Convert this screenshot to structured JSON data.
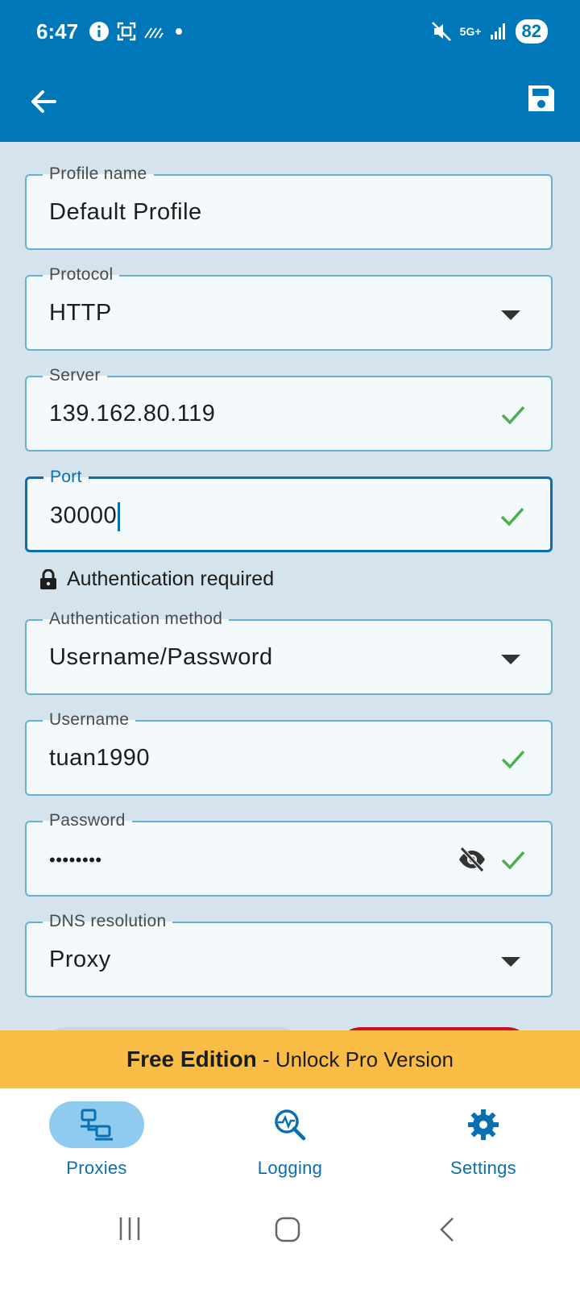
{
  "status": {
    "time": "6:47",
    "network": "5G+",
    "battery": "82"
  },
  "appbar": {
    "back_icon": "arrow-left-icon",
    "save_icon": "save-icon"
  },
  "fields": {
    "profile_name": {
      "label": "Profile name",
      "value": "Default Profile"
    },
    "protocol": {
      "label": "Protocol",
      "value": "HTTP"
    },
    "server": {
      "label": "Server",
      "value": "139.162.80.119"
    },
    "port": {
      "label": "Port",
      "value": "30000"
    },
    "auth_method": {
      "label": "Authentication method",
      "value": "Username/Password"
    },
    "username": {
      "label": "Username",
      "value": "tuan1990"
    },
    "password": {
      "label": "Password",
      "value": "••••••••"
    },
    "dns": {
      "label": "DNS resolution",
      "value": "Proxy"
    }
  },
  "auth_note": "Authentication required",
  "promo": {
    "bold": "Free Edition",
    "rest": " - Unlock Pro Version"
  },
  "nav": {
    "proxies": "Proxies",
    "logging": "Logging",
    "settings": "Settings"
  },
  "colors": {
    "primary": "#0077b8",
    "accent": "#0a6fb0",
    "check": "#4caf50",
    "promo": "#f9bd45",
    "danger": "#c9102f"
  }
}
